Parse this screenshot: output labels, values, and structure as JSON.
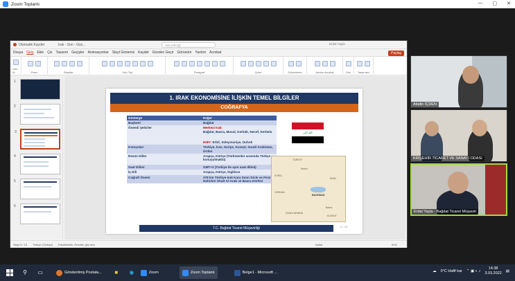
{
  "window": {
    "title": "Zoom Toplantı",
    "controls": [
      "—",
      "▢",
      "✕"
    ]
  },
  "powerpoint": {
    "autosave": "Otomatik Kaydet",
    "filename": "Irak - Son - Güz...",
    "search_placeholder": "Ara (Alt+Q)",
    "user": "Erdal Yayla",
    "share": "Paylaş",
    "menu": [
      "Dosya",
      "Giriş",
      "Ekle",
      "Çiz",
      "Tasarım",
      "Geçişler",
      "Animasyonlar",
      "Slayt Gösterisi",
      "Kaydet",
      "Gözden Geçir",
      "Görünüm",
      "Yardım",
      "Acrobat"
    ],
    "active_menu": "Giriş",
    "ribbon_groups": [
      {
        "label": "Geri Al",
        "w": 16
      },
      {
        "label": "Pano",
        "w": 38
      },
      {
        "label": "Slaytlar",
        "w": 60
      },
      {
        "label": "Yazı Tipi",
        "w": 110
      },
      {
        "label": "Paragraf",
        "w": 98
      },
      {
        "label": "Çizim",
        "w": 72
      },
      {
        "label": "Düzenleme",
        "w": 34
      },
      {
        "label": "Adobe Acrobat",
        "w": 52
      },
      {
        "label": "Ses",
        "w": 16
      },
      {
        "label": "Tasarımcı",
        "w": 28
      }
    ],
    "slide_count_label": "Slayt 3 / 15",
    "status_lang": "Türkçe (Türkiye)",
    "status_access": "Erişilebilirlik: Öneriler göz atın",
    "status_notes": "Notlar",
    "zoom": "51%"
  },
  "thumbnails": [
    "1",
    "2",
    "3",
    "4",
    "5",
    "6"
  ],
  "slide": {
    "title": "1. IRAK EKONOMİSİNE İLİŞKİN TEMEL BİLGİLER",
    "subtitle": "COĞRAFYA",
    "table_header": {
      "k": "Gösterge",
      "v": "Değer"
    },
    "rows": [
      {
        "k": "Başkent",
        "v": "Bağdat",
        "style": "band"
      },
      {
        "k": "Önemli Şehirler",
        "v_red": "Merkezi Irak:",
        "v": "Bağdat, Basra, Musul, Kerkük, Necef, Kerbela",
        "v2_red": "IKBY:",
        "v2": "Erbil, Süleymaniye, Duhok",
        "style": "plain"
      },
      {
        "k": "Komşuları",
        "v": "Türkiye, İran, Suriye, Kuveyt, Suudi Arabistan, Ürdün",
        "style": "band"
      },
      {
        "k": "Resmi Diller",
        "v": "Arapça, Kürtçe (Türkmenler arasında Türkçe konuşulmakta)",
        "style": "plain"
      },
      {
        "k": "Saat Dilimi",
        "v": "GMT+3 (Türkiye ile aynı saat dilimi)",
        "style": "band"
      },
      {
        "k": "İş Dili",
        "v": "Arapça, Kürtçe, İngilizce",
        "style": "plain"
      },
      {
        "k": "Coğrafi Önemi",
        "v": "378 km Türkiye-Irak Kara Sınırı Dicle ve Fırat Nehirleri Shatt Al-Arab ve Basra Körfezi",
        "style": "band"
      }
    ],
    "flag_text": "الله اكبر",
    "map_labels": {
      "turkey": "TURKEY",
      "syria": "SYRIA",
      "iran": "IRAN",
      "baghdad": "BAGHDAD",
      "saudi": "SAUDI ARABIA",
      "jordan": "JORDAN",
      "kuwait": "KUWAIT",
      "mosul": "Mosul",
      "basra": "Basra"
    },
    "footer": "T.C. Bağdat Ticaret Müşavirliği",
    "page": "3 / 15"
  },
  "participants": [
    {
      "name": "Abidin İÇDEN"
    },
    {
      "name": "KIRŞEHİR TİCARET VE SANAYİ ODASI"
    },
    {
      "name": "Erdal Yayla - Bağdat Ticaret Müşaviri"
    }
  ],
  "taskbar": {
    "apps": [
      {
        "label": "Gönderilmiş Postala...",
        "color": "#e2762b",
        "running": false
      },
      {
        "label": "Zoom",
        "color": "#2d8cff",
        "running": false
      },
      {
        "label": "Zoom Toplantı",
        "color": "#2d8cff",
        "running": true
      },
      {
        "label": "Belge1 - Microsoft ...",
        "color": "#2b579a",
        "running": false
      }
    ],
    "weather": "0°C Hafif kar",
    "time": "14:38",
    "date": "3.03.2022"
  }
}
